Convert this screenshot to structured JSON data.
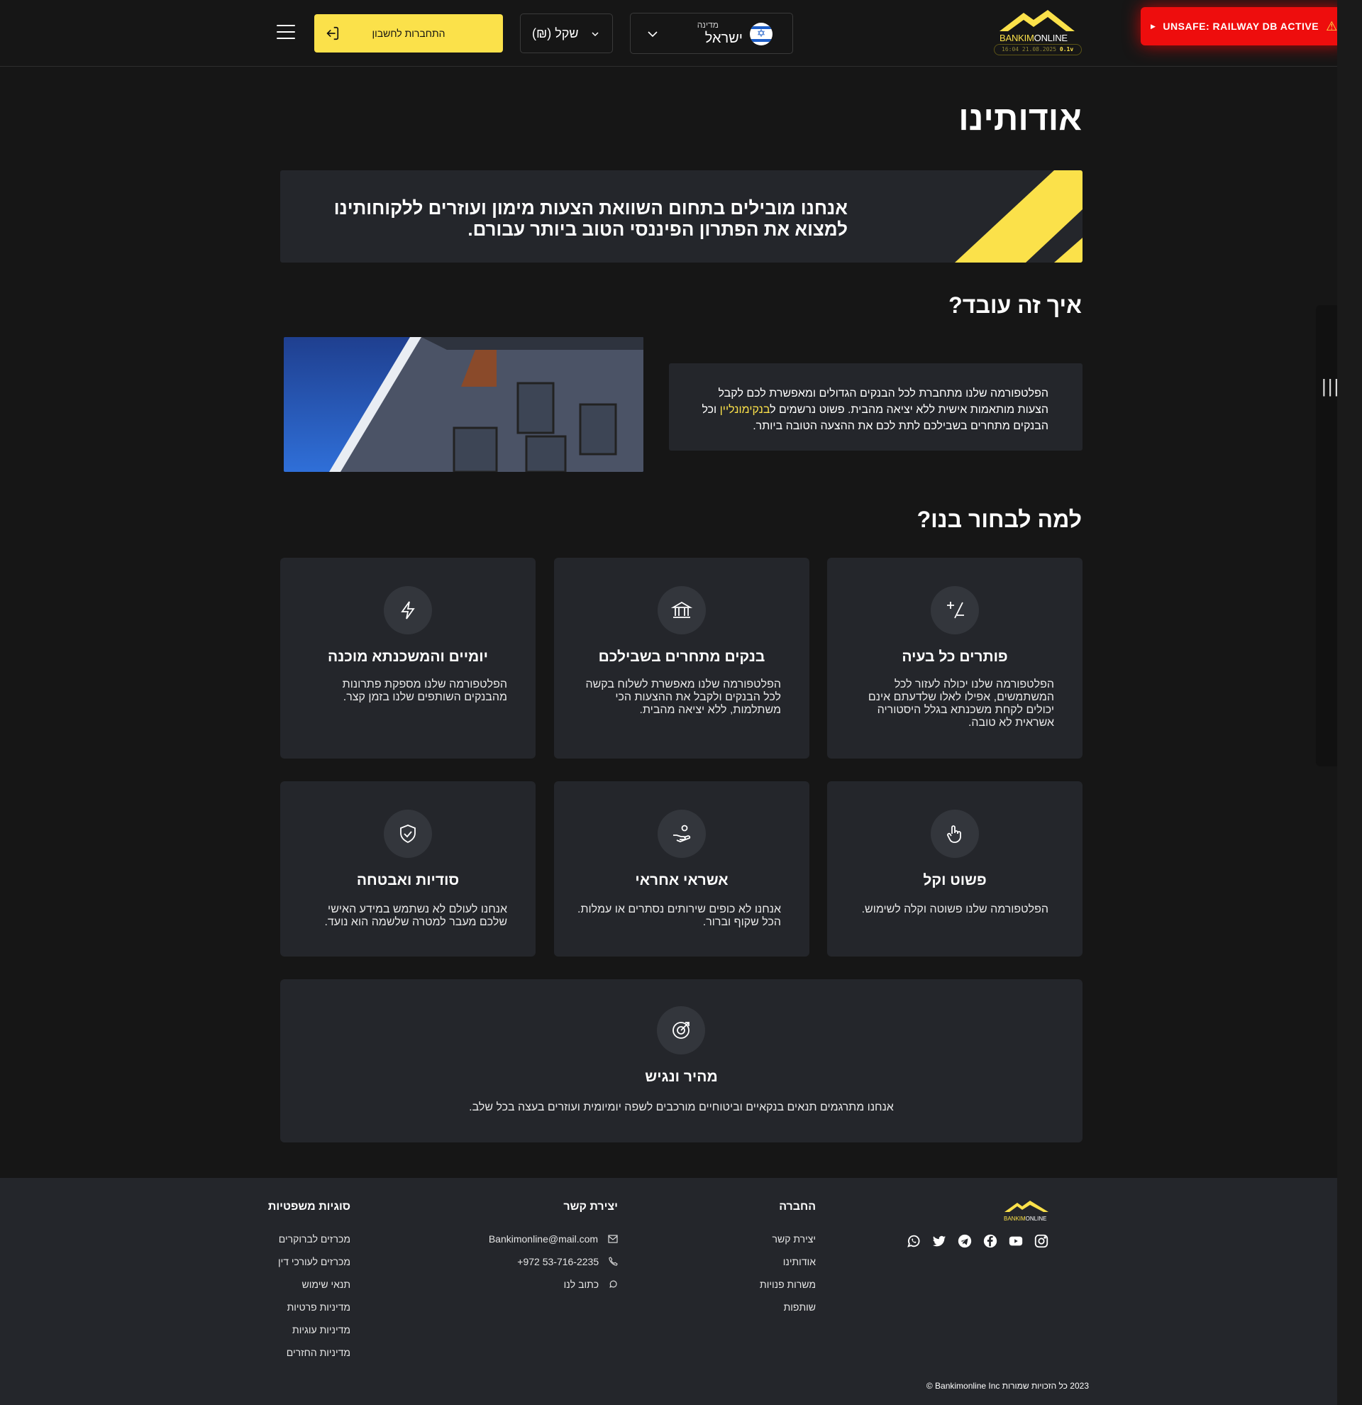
{
  "header": {
    "login_label": "התחברות לחשבון",
    "currency_label": "שקל (₪)",
    "country_caption": "מדינה",
    "country_value": "ישראל",
    "logo_prefix": "BANKIM",
    "logo_suffix": "ONLINE",
    "version_time": "16:04 21.08.2025",
    "version_number": "0.1v",
    "unsafe_label": "UNSAFE: RAILWAY DB ACTIVE"
  },
  "page": {
    "title": "אודותינו",
    "hero_text": "אנחנו מובילים בתחום השוואת הצעות מימון ועוזרים ללקוחותינו למצוא את הפתרון הפיננסי הטוב ביותר עבורם.",
    "how_title": "איך זה עובד?",
    "how_text_part1": "הפלטפורמה שלנו מתחברת לכל הבנקים הגדולים ומאפשרת לכם לקבל הצעות מותאמות אישית ללא יציאה מהבית. פשוט נרשמים ל",
    "how_text_highlight": "בנקימונליין",
    "how_text_part2": " וכל הבנקים מתחרים בשבילכם לתת לכם את ההצעה הטובה ביותר.",
    "why_title": "למה לבחור בנו?"
  },
  "features": [
    {
      "icon": "plus-minus-icon",
      "title": "פותרים כל בעיה",
      "desc": "הפלטפורמה שלנו יכולה לעזור לכל המשתמשים, אפילו לאלו שלדעתם אינם יכולים לקחת משכנתא בגלל היסטוריה אשראית לא טובה."
    },
    {
      "icon": "bank-icon",
      "title": "בנקים מתחרים בשבילכם",
      "desc": "הפלטפורמה שלנו מאפשרת לשלוח בקשה לכל הבנקים ולקבל את ההצעות הכי משתלמות, ללא יציאה מהבית."
    },
    {
      "icon": "lightning-icon",
      "title": "יומיים והמשכנתא מוכנה",
      "desc": "הפלטפורמה שלנו מספקת פתרונות מהבנקים השותפים שלנו בזמן קצר."
    },
    {
      "icon": "pointer-hand-icon",
      "title": "פשוט וקל",
      "desc": "הפלטפורמה שלנו פשוטה וקלה לשימוש."
    },
    {
      "icon": "hand-coin-icon",
      "title": "אשראי אחראי",
      "desc": "אנחנו לא כופים שירותים נסתרים או עמלות. הכל שקוף וברור."
    },
    {
      "icon": "shield-check-icon",
      "title": "סודיות ואבטחה",
      "desc": "אנחנו לעולם לא נשתמש במידע האישי שלכם מעבר למטרה שלשמה הוא נועד."
    },
    {
      "icon": "target-icon",
      "title": "מהיר ונגיש",
      "desc": "אנחנו מתרגמים תנאים בנקאיים וביטוחיים מורכבים לשפה יומיומית ועוזרים בעצה בכל שלב."
    }
  ],
  "footer": {
    "company_title": "החברה",
    "company_links": [
      "יצירת קשר",
      "אודותינו",
      "משרות פנויות",
      "שותפות"
    ],
    "contact_title": "יצירת קשר",
    "contact_email": "Bankimonline@mail.com",
    "contact_phone": "+972 53-716-2235",
    "contact_write": "כתוב לנו",
    "legal_title": "סוגיות משפטיות",
    "legal_links": [
      "מכרזים לברוקרים",
      "מכרזים לעורכי דין",
      "תנאי שימוש",
      "מדיניות פרטיות",
      "מדיניות עוגיות",
      "מדיניות החזרים"
    ],
    "copyright": "2023 כל הזכויות שמורות Bankimonline Inc ©",
    "social_icons": [
      "instagram-icon",
      "youtube-icon",
      "facebook-icon",
      "telegram-icon",
      "twitter-icon",
      "whatsapp-icon"
    ]
  },
  "colors": {
    "background": "#161616",
    "card": "#24262b",
    "accent": "#fbe14a",
    "danger": "#ee0d0d"
  }
}
